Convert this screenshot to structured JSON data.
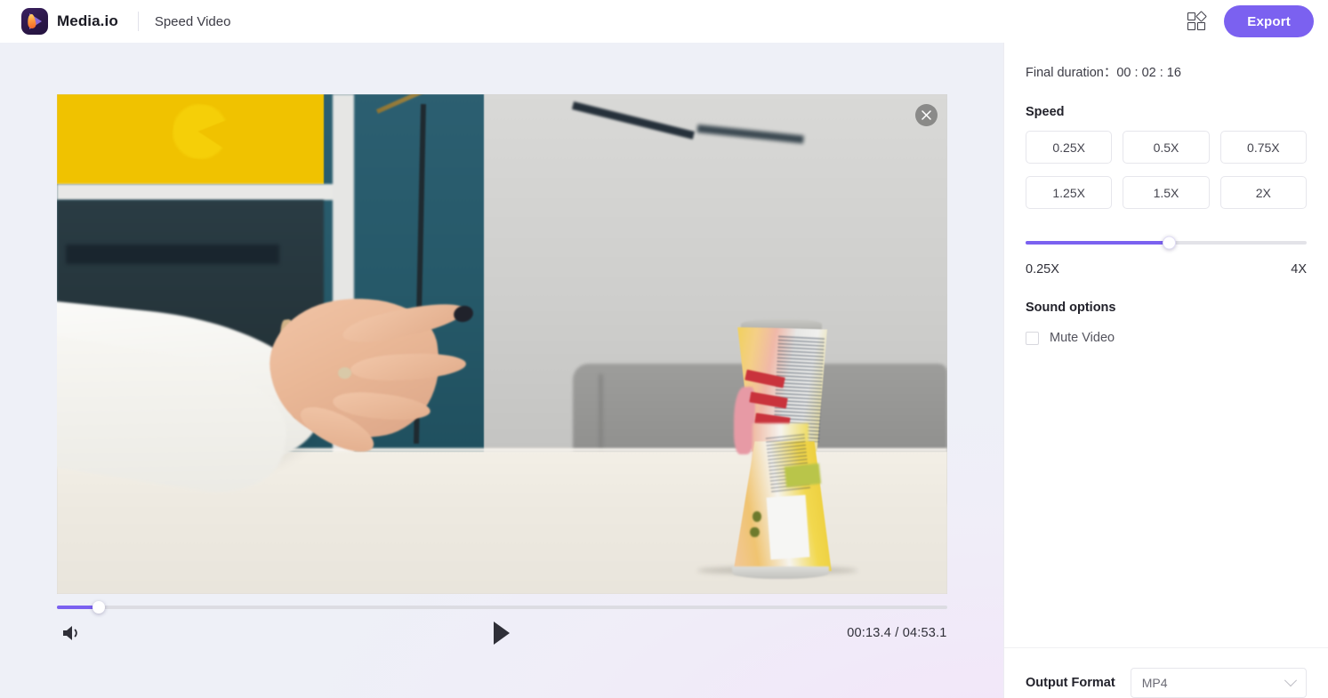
{
  "topbar": {
    "brand_name": "Media.io",
    "page_title": "Speed Video",
    "grid_icon": "grid-apps-icon",
    "export_label": "Export"
  },
  "player": {
    "close_icon": "close-icon",
    "volume_icon": "volume-on-icon",
    "play_icon": "play-icon",
    "time_display": "00:13.4 / 04:53.1",
    "current_time": "00:13.4",
    "total_time": "04:53.1",
    "progress_percent": 4.7
  },
  "panel": {
    "final_duration_label": "Final duration：",
    "final_duration_value": "00 : 02 : 16",
    "speed_section_title": "Speed",
    "speed_options": [
      {
        "label": "0.25X",
        "selected": false
      },
      {
        "label": "0.5X",
        "selected": false
      },
      {
        "label": "0.75X",
        "selected": false
      },
      {
        "label": "1.25X",
        "selected": false
      },
      {
        "label": "1.5X",
        "selected": false
      },
      {
        "label": "2X",
        "selected": false
      }
    ],
    "slider": {
      "min_label": "0.25X",
      "max_label": "4X",
      "value_percent": 51
    },
    "sound_section_title": "Sound options",
    "mute_label": "Mute Video",
    "mute_checked": false,
    "output_format_label": "Output Format",
    "output_format_value": "MP4",
    "output_format_chevron": "chevron-down-icon"
  },
  "colors": {
    "accent": "#7b61f0",
    "canvas_bg": "#eef0f7",
    "panel_bg": "#ffffff",
    "text_primary": "#22222b",
    "text_secondary": "#53535d"
  }
}
